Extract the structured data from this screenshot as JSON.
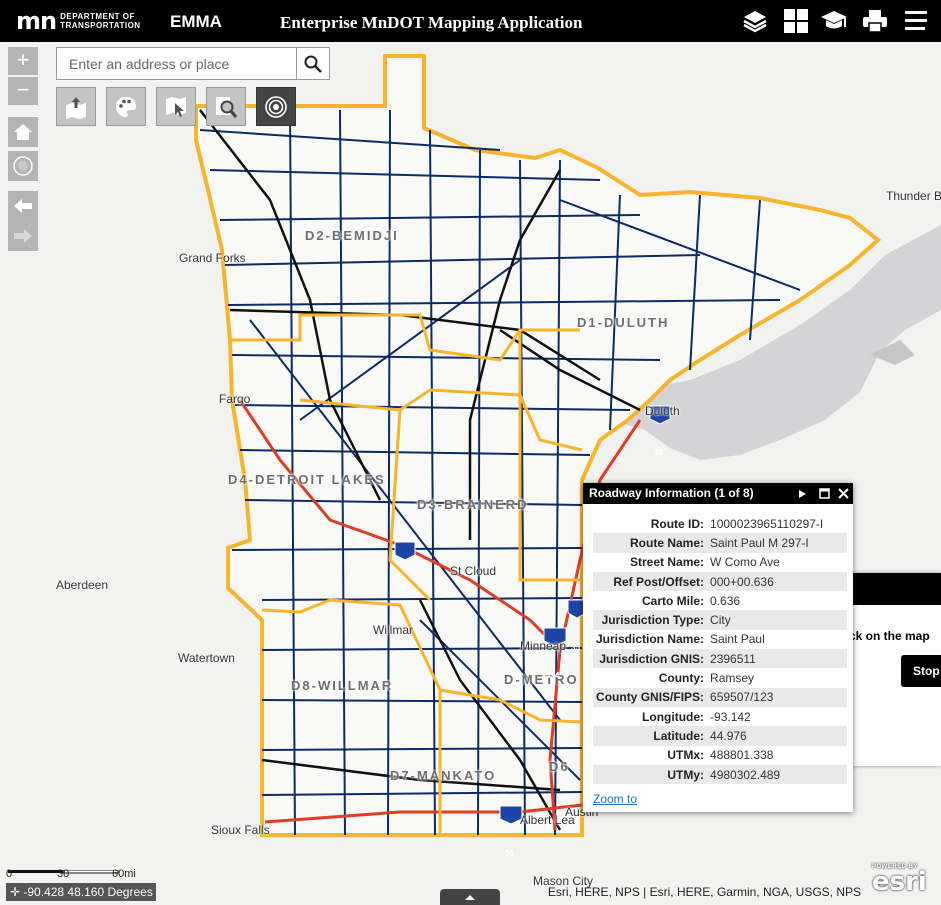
{
  "header": {
    "logo_mark": "mn",
    "logo_line1": "DEPARTMENT OF",
    "logo_line2": "TRANSPORTATION",
    "app_short": "EMMA",
    "app_title": "Enterprise MnDOT Mapping Application",
    "icons": [
      "layers-icon",
      "basemap-grid-icon",
      "graduation-cap-icon",
      "printer-icon",
      "menu-icon"
    ]
  },
  "search": {
    "placeholder": "Enter an address or place"
  },
  "zoom": {
    "in": "+",
    "out": "−"
  },
  "tools": [
    "map-upload-icon",
    "palette-icon",
    "touch-select-icon",
    "map-search-icon",
    "target-icon"
  ],
  "map_labels": {
    "places": {
      "thunder_bay": "Thunder B",
      "grand_forks": "Grand Forks",
      "fargo": "Fargo",
      "duluth": "Duluth",
      "st_cloud": "St Cloud",
      "aberdeen": "Aberdeen",
      "watertown": "Watertown",
      "willmar": "Willmar",
      "minneapolis": "Minneap",
      "sioux_falls": "Sioux Falls",
      "albert_lea": "Albert Lea",
      "austin": "Austin",
      "mason_city": "Mason City"
    },
    "districts": {
      "d2": "D2-BEMIDJI",
      "d1": "D1-DULUTH",
      "d4": "D4-DETROIT LAKES",
      "d3": "D3-BRAINERD",
      "d8": "D8-WILLMAR",
      "metro": "D-METRO",
      "d7": "D7-MANKATO",
      "d6": "D6"
    },
    "shields": [
      "94",
      "35",
      "494",
      "35",
      "90"
    ]
  },
  "popup": {
    "title": "Roadway Information (1 of 8)",
    "rows": [
      {
        "label": "Route ID:",
        "value": "1000023965110297-I"
      },
      {
        "label": "Route Name:",
        "value": "Saint Paul M 297-I"
      },
      {
        "label": "Street Name:",
        "value": "W Como Ave"
      },
      {
        "label": "Ref Post/Offset:",
        "value": "000+00.636"
      },
      {
        "label": "Carto Mile:",
        "value": "0.636"
      },
      {
        "label": "Jurisdiction Type:",
        "value": "City"
      },
      {
        "label": "Jurisdiction Name:",
        "value": "Saint Paul"
      },
      {
        "label": "Jurisdiction GNIS:",
        "value": "2396511"
      },
      {
        "label": "County:",
        "value": "Ramsey"
      },
      {
        "label": "County GNIS/FIPS:",
        "value": "659507/123"
      },
      {
        "label": "Longitude:",
        "value": "-93.142"
      },
      {
        "label": "Latitude:",
        "value": "44.976"
      },
      {
        "label": "UTMx:",
        "value": "488801.338"
      },
      {
        "label": "UTMy:",
        "value": "4980302.489"
      }
    ],
    "zoom_link": "Zoom to"
  },
  "side_panel": {
    "text": "ck on the map",
    "button": "Stop"
  },
  "scale": {
    "s0": "0",
    "s1": "30",
    "s2": "60mi"
  },
  "coords": "-90.428 48.160 Degrees",
  "attribution": "Esri, HERE, NPS | Esri, HERE, Garmin, NGA, USGS, NPS",
  "esri": {
    "powered": "POWERED BY",
    "name": "esri"
  },
  "colors": {
    "district_boundary": "#f7b42c",
    "trunk_highway": "#0c2a66",
    "interstate_blue": "#1f44a8",
    "major_road": "#111111",
    "hwy_red": "#e03b24",
    "lake_superior": "#d4d4d6"
  }
}
